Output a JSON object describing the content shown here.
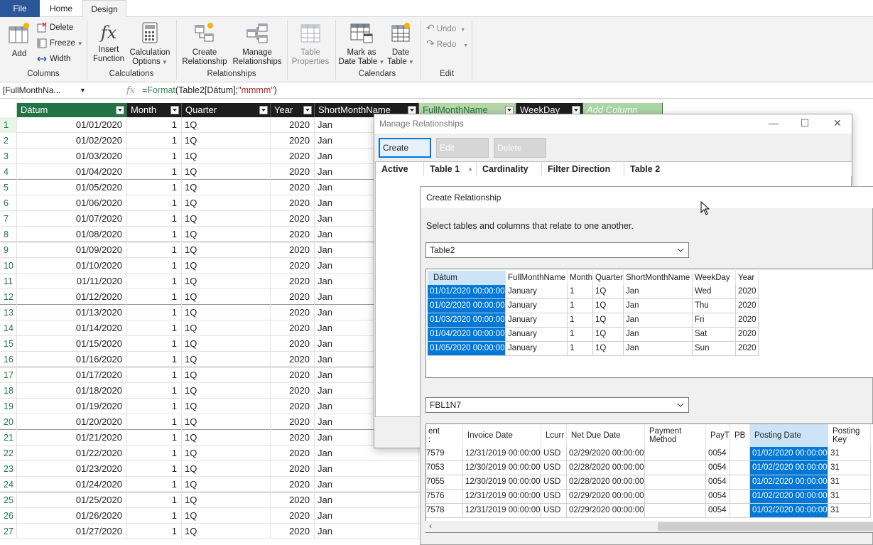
{
  "tabs": {
    "file": "File",
    "home": "Home",
    "design": "Design"
  },
  "ribbon": {
    "columns": {
      "add": "Add",
      "delete": "Delete",
      "freeze": "Freeze",
      "width": "Width",
      "label": "Columns"
    },
    "calculations": {
      "insert_function": [
        "Insert",
        "Function"
      ],
      "calculation_options": [
        "Calculation",
        "Options"
      ],
      "label": "Calculations"
    },
    "relationships": {
      "create": [
        "Create",
        "Relationship"
      ],
      "manage": [
        "Manage",
        "Relationships"
      ],
      "label": "Relationships"
    },
    "table_properties": [
      "Table",
      "Properties"
    ],
    "calendars": {
      "mark_as": [
        "Mark as",
        "Date Table"
      ],
      "date_table": [
        "Date",
        "Table"
      ],
      "label": "Calendars"
    },
    "edit": {
      "undo": "Undo",
      "redo": "Redo",
      "label": "Edit"
    }
  },
  "formula_bar": {
    "name_box": "[FullMonthNa...",
    "fx": "fx",
    "formula_eq": "=",
    "formula_fn": "Format",
    "formula_mid": "(Table2[Dátum];",
    "formula_str": "\"mmmm\"",
    "formula_end": ")"
  },
  "grid": {
    "headers": [
      "Dátum",
      "Month",
      "Quarter",
      "Year",
      "ShortMonthName",
      "FullMonthName",
      "WeekDay",
      "Add Column"
    ],
    "rows": [
      [
        "1",
        "01/01/2020",
        "1",
        "1Q",
        "2020",
        "Jan"
      ],
      [
        "2",
        "01/02/2020",
        "1",
        "1Q",
        "2020",
        "Jan"
      ],
      [
        "3",
        "01/03/2020",
        "1",
        "1Q",
        "2020",
        "Jan"
      ],
      [
        "4",
        "01/04/2020",
        "1",
        "1Q",
        "2020",
        "Jan"
      ],
      [
        "5",
        "01/05/2020",
        "1",
        "1Q",
        "2020",
        "Jan"
      ],
      [
        "6",
        "01/06/2020",
        "1",
        "1Q",
        "2020",
        "Jan"
      ],
      [
        "7",
        "01/07/2020",
        "1",
        "1Q",
        "2020",
        "Jan"
      ],
      [
        "8",
        "01/08/2020",
        "1",
        "1Q",
        "2020",
        "Jan"
      ],
      [
        "9",
        "01/09/2020",
        "1",
        "1Q",
        "2020",
        "Jan"
      ],
      [
        "10",
        "01/10/2020",
        "1",
        "1Q",
        "2020",
        "Jan"
      ],
      [
        "11",
        "01/11/2020",
        "1",
        "1Q",
        "2020",
        "Jan"
      ],
      [
        "12",
        "01/12/2020",
        "1",
        "1Q",
        "2020",
        "Jan"
      ],
      [
        "13",
        "01/13/2020",
        "1",
        "1Q",
        "2020",
        "Jan"
      ],
      [
        "14",
        "01/14/2020",
        "1",
        "1Q",
        "2020",
        "Jan"
      ],
      [
        "15",
        "01/15/2020",
        "1",
        "1Q",
        "2020",
        "Jan"
      ],
      [
        "16",
        "01/16/2020",
        "1",
        "1Q",
        "2020",
        "Jan"
      ],
      [
        "17",
        "01/17/2020",
        "1",
        "1Q",
        "2020",
        "Jan"
      ],
      [
        "18",
        "01/18/2020",
        "1",
        "1Q",
        "2020",
        "Jan"
      ],
      [
        "19",
        "01/19/2020",
        "1",
        "1Q",
        "2020",
        "Jan"
      ],
      [
        "20",
        "01/20/2020",
        "1",
        "1Q",
        "2020",
        "Jan"
      ],
      [
        "21",
        "01/21/2020",
        "1",
        "1Q",
        "2020",
        "Jan"
      ],
      [
        "22",
        "01/22/2020",
        "1",
        "1Q",
        "2020",
        "Jan"
      ],
      [
        "23",
        "01/23/2020",
        "1",
        "1Q",
        "2020",
        "Jan"
      ],
      [
        "24",
        "01/24/2020",
        "1",
        "1Q",
        "2020",
        "Jan"
      ],
      [
        "25",
        "01/25/2020",
        "1",
        "1Q",
        "2020",
        "Jan"
      ],
      [
        "26",
        "01/26/2020",
        "1",
        "1Q",
        "2020",
        "Jan"
      ],
      [
        "27",
        "01/27/2020",
        "1",
        "1Q",
        "2020",
        "Jan"
      ]
    ]
  },
  "manage_dialog": {
    "title": "Manage Relationships",
    "buttons": {
      "create": "Create",
      "edit": "Edit",
      "delete": "Delete"
    },
    "columns": [
      "Active",
      "Table 1",
      "Cardinality",
      "Filter Direction",
      "Table 2"
    ]
  },
  "create_dialog": {
    "title": "Create Relationship",
    "instruction": "Select tables and columns that relate to one another.",
    "table1": {
      "selected": "Table2",
      "headers": [
        "Dátum",
        "FullMonthName",
        "Month",
        "Quarter",
        "ShortMonthName",
        "WeekDay",
        "Year"
      ],
      "rows": [
        [
          "01/01/2020 00:00:00",
          "January",
          "1",
          "1Q",
          "Jan",
          "Wed",
          "2020"
        ],
        [
          "01/02/2020 00:00:00",
          "January",
          "1",
          "1Q",
          "Jan",
          "Thu",
          "2020"
        ],
        [
          "01/03/2020 00:00:00",
          "January",
          "1",
          "1Q",
          "Jan",
          "Fri",
          "2020"
        ],
        [
          "01/04/2020 00:00:00",
          "January",
          "1",
          "1Q",
          "Jan",
          "Sat",
          "2020"
        ],
        [
          "01/05/2020 00:00:00",
          "January",
          "1",
          "1Q",
          "Jan",
          "Sun",
          "2020"
        ]
      ]
    },
    "table2": {
      "selected": "FBL1N7",
      "headers": [
        "ent\n:",
        "Invoice Date",
        "Lcurr",
        "Net Due Date",
        "Payment\nMethod",
        "PayT",
        "PB",
        "Posting Date",
        "Posting\nKey"
      ],
      "rows": [
        [
          "7579",
          "12/31/2019 00:00:00",
          "USD",
          "02/29/2020 00:00:00",
          "",
          "0054",
          "",
          "01/02/2020 00:00:00",
          "31"
        ],
        [
          "7053",
          "12/30/2019 00:00:00",
          "USD",
          "02/28/2020 00:00:00",
          "",
          "0054",
          "",
          "01/02/2020 00:00:00",
          "31"
        ],
        [
          "7055",
          "12/30/2019 00:00:00",
          "USD",
          "02/28/2020 00:00:00",
          "",
          "0054",
          "",
          "01/02/2020 00:00:00",
          "31"
        ],
        [
          "7576",
          "12/31/2019 00:00:00",
          "USD",
          "02/29/2020 00:00:00",
          "",
          "0054",
          "",
          "01/02/2020 00:00:00",
          "31"
        ],
        [
          "7578",
          "12/31/2019 00:00:00",
          "USD",
          "02/29/2020 00:00:00",
          "",
          "0054",
          "",
          "01/02/2020 00:00:00",
          "31"
        ]
      ]
    }
  }
}
